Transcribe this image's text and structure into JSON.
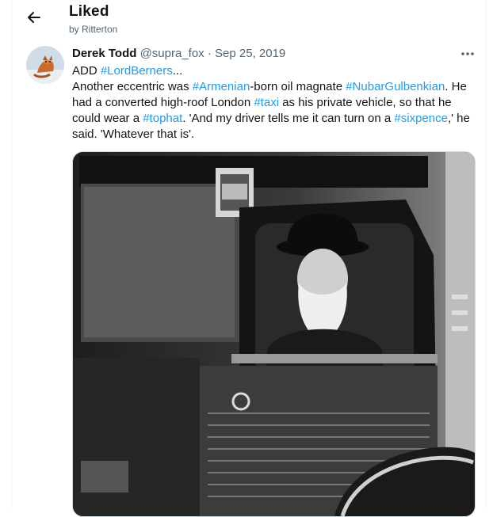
{
  "header": {
    "title": "Liked",
    "subtitle": "by Ritterton"
  },
  "tweet": {
    "author_name": "Derek Todd",
    "author_handle": "@supra_fox",
    "separator": " · ",
    "date": "Sep 25, 2019",
    "text": {
      "l1_prefix": "ADD ",
      "l1_tag": "#LordBerners",
      "l1_suffix": "...",
      "l2_a": "Another eccentric was ",
      "l2_tag1": "#Armenian",
      "l2_b": "-born oil magnate ",
      "l2_tag2": "#NubarGulbenkian",
      "l2_c": ". He had a converted high-roof London ",
      "l2_tag3": "#taxi",
      "l2_d": " as his private vehicle, so that he could wear a ",
      "l2_tag4": "#tophat",
      "l2_e": ". 'And my driver tells me it can turn on a ",
      "l2_tag5": "#sixpence",
      "l2_f": ",' he said. 'Whatever that is'."
    }
  },
  "icons": {
    "back": "arrow-left-icon",
    "more": "more-horizontal-icon"
  },
  "colors": {
    "link": "#1d9bf0",
    "secondary_text": "#536471",
    "border": "#cfd9de"
  }
}
